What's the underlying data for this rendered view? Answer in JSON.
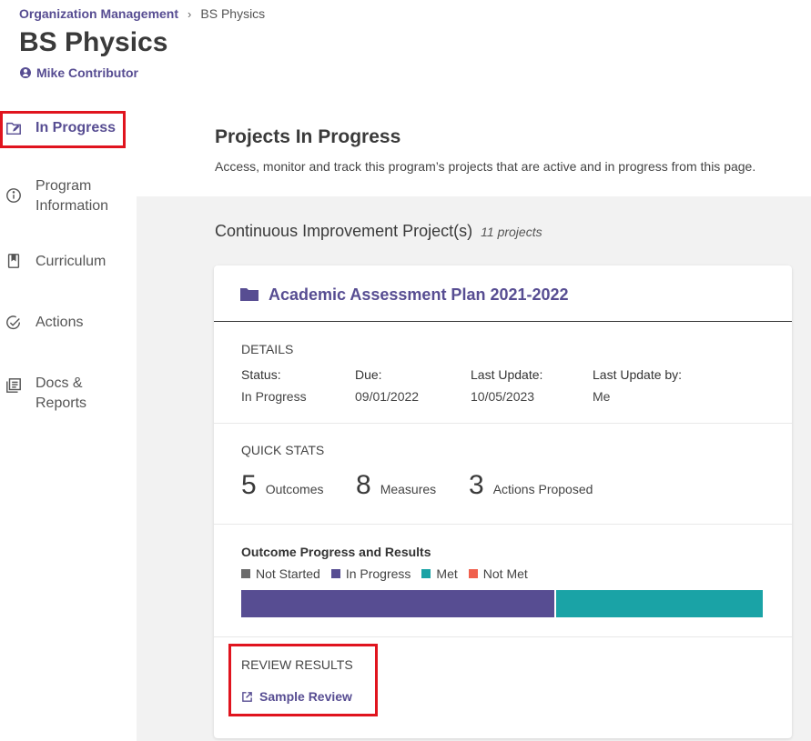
{
  "breadcrumb": {
    "parent": "Organization Management",
    "separator": "›",
    "current": "BS Physics"
  },
  "page": {
    "title": "BS Physics",
    "contributor": "Mike Contributor"
  },
  "sidebar": {
    "items": [
      {
        "label": "In Progress",
        "icon": "edit-folder-icon",
        "active": true
      },
      {
        "label": "Program Information",
        "icon": "info-icon"
      },
      {
        "label": "Curriculum",
        "icon": "bookmark-icon"
      },
      {
        "label": "Actions",
        "icon": "check-circle-icon"
      },
      {
        "label": "Docs & Reports",
        "icon": "documents-icon"
      }
    ]
  },
  "main": {
    "title": "Projects In Progress",
    "description": "Access, monitor and track this program’s projects that are active and in progress from this page.",
    "section_heading": "Continuous Improvement Project(s)",
    "section_count": "11 projects"
  },
  "project": {
    "title": "Academic Assessment Plan 2021-2022",
    "details_label": "DETAILS",
    "details": [
      {
        "label": "Status:",
        "value": "In Progress"
      },
      {
        "label": "Due:",
        "value": "09/01/2022"
      },
      {
        "label": "Last Update:",
        "value": "10/05/2023"
      },
      {
        "label": "Last Update by:",
        "value": "Me"
      }
    ],
    "quick_stats_label": "QUICK STATS",
    "stats": [
      {
        "number": "5",
        "label": "Outcomes"
      },
      {
        "number": "8",
        "label": "Measures"
      },
      {
        "number": "3",
        "label": "Actions Proposed"
      }
    ],
    "outcome_progress_label": "Outcome Progress and Results",
    "legend": [
      {
        "label": "Not Started",
        "color": "#6b6b6b"
      },
      {
        "label": "In Progress",
        "color": "#574d92"
      },
      {
        "label": "Met",
        "color": "#1aa3a6"
      },
      {
        "label": "Not Met",
        "color": "#f0604d"
      }
    ],
    "progress": {
      "not_started": 0,
      "in_progress": 3,
      "met": 2,
      "not_met": 0
    },
    "review_label": "REVIEW RESULTS",
    "review_link": "Sample Review"
  },
  "colors": {
    "accent": "#574d92",
    "highlight": "#e0141e",
    "met": "#1aa3a6"
  }
}
